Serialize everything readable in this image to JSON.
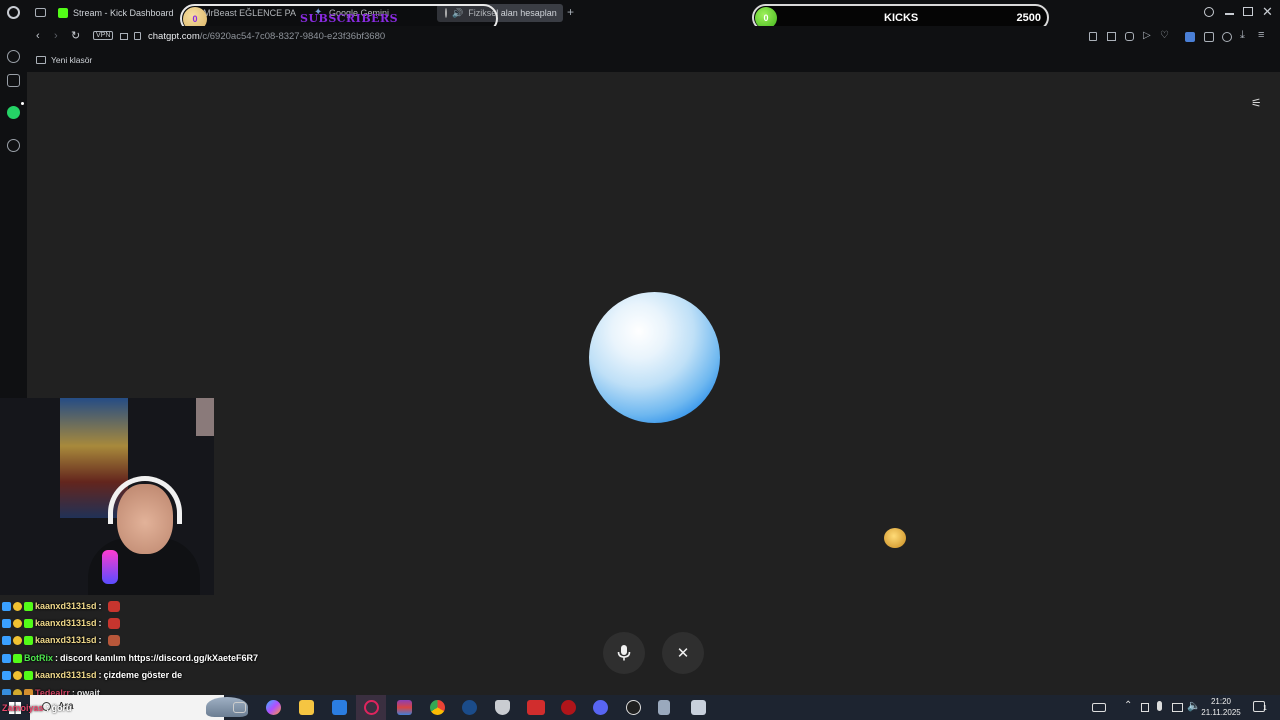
{
  "browser": {
    "tabs": [
      {
        "label": "Stream - Kick Dashboard",
        "icon": "kick-icon"
      },
      {
        "label": "MrBeast EĞLENCE PA",
        "icon": "youtube-icon"
      },
      {
        "label": "Google Gemini",
        "icon": "gemini-icon"
      },
      {
        "label": "Fiziksel alan hesaplan",
        "icon": "chatgpt-icon"
      }
    ],
    "url_host": "chatgpt.com",
    "url_path": "/c/6920ac54-7c08-8327-9840-e23f36bf3680",
    "vpn_label": "VPN",
    "bookmark_folder": "Yeni klasör"
  },
  "overlay": {
    "subscribers_label": "SUBSCRIBERS",
    "subscribers_count": "0",
    "kicks_label": "KICKS",
    "kicks_count": "0",
    "kicks_goal": "2500"
  },
  "chat": [
    {
      "user": "kaanxd3131sd",
      "message": "",
      "user_color": "#f0d98a"
    },
    {
      "user": "kaanxd3131sd",
      "message": "",
      "user_color": "#f0d98a"
    },
    {
      "user": "kaanxd3131sd",
      "message": "",
      "user_color": "#f0d98a"
    },
    {
      "user": "BotRix",
      "message": "discord kanılım https://discord.gg/kXaeteF6R7",
      "user_color": "#4ee64e"
    },
    {
      "user": "kaanxd3131sd",
      "message": "çizdeme göster de",
      "user_color": "#f0d98a"
    },
    {
      "user": "Tedealrr",
      "message": "owait",
      "user_color": "#e8476b"
    },
    {
      "user": "Zamoiyas",
      "message": "ğoru",
      "user_color": "#e8476b"
    }
  ],
  "taskbar": {
    "search_label": "Ara",
    "time": "21:20",
    "date": "21.11.2025",
    "notification_count": "1"
  },
  "colors": {
    "background": "#212121",
    "orb_blue": "#1e86e8",
    "kick_green": "#53fc18"
  }
}
